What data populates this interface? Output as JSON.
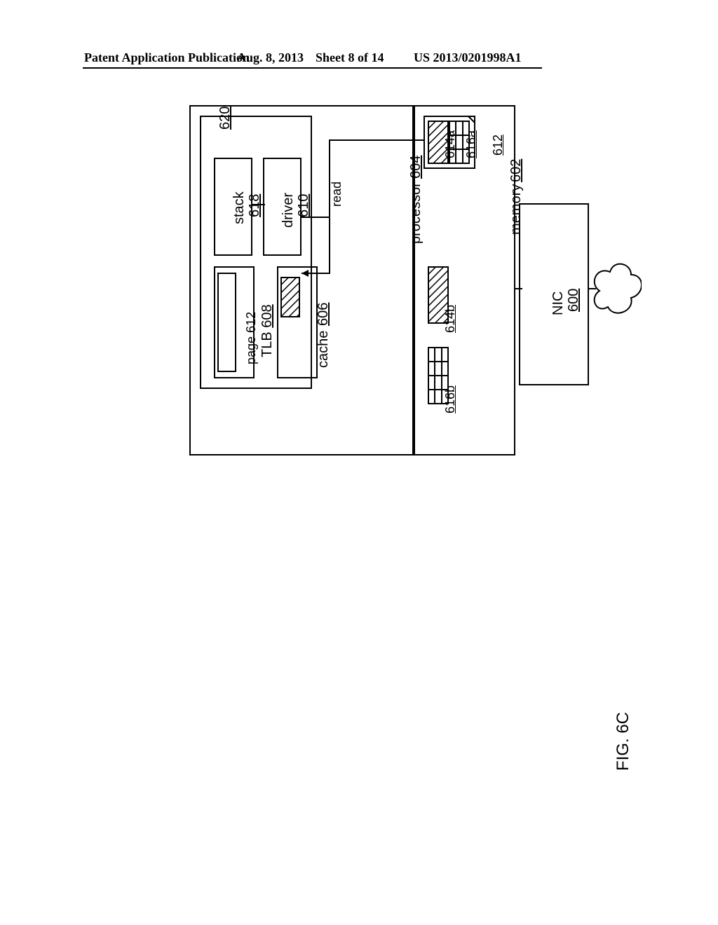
{
  "header": {
    "publication": "Patent Application Publication",
    "date": "Aug. 8, 2013",
    "sheet": "Sheet 8 of 14",
    "appno": "US 2013/0201998A1"
  },
  "figure_label": "FIG. 6C",
  "processor": {
    "label": "processor",
    "ref": "604"
  },
  "context": {
    "ref": "620"
  },
  "stack": {
    "label": "stack",
    "ref": "618"
  },
  "driver": {
    "label": "driver",
    "ref": "610"
  },
  "tlb": {
    "label": "TLB",
    "ref": "608"
  },
  "page": {
    "label": "page",
    "ref": "612"
  },
  "cache": {
    "label": "cache",
    "ref": "606"
  },
  "read_label": "read",
  "memory": {
    "label": "memory",
    "ref": "602"
  },
  "desc_a": {
    "ref": "614a"
  },
  "pkt_a": {
    "ref": "616a"
  },
  "page_mem": {
    "ref": "612"
  },
  "desc_b": {
    "ref": "614b"
  },
  "pkt_b": {
    "ref": "616b"
  },
  "nic": {
    "label": "NIC",
    "ref": "600"
  }
}
